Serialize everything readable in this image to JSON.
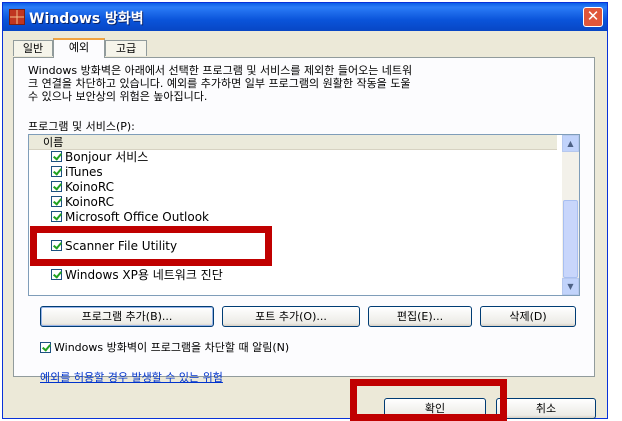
{
  "window": {
    "title": "Windows 방화벽",
    "close_symbol": "✕"
  },
  "tabs": [
    {
      "label": "일반"
    },
    {
      "label": "예외"
    },
    {
      "label": "고급"
    }
  ],
  "description_lines": [
    "Windows 방화벽은 아래에서 선택한 프로그램 및 서비스를 제외한 들어오는 네트워",
    "크 연결을 차단하고 있습니다. 예외를 추가하면 일부 프로그램의 원활한 작동을 도울",
    "수 있으나 보안상의 위험은 높아집니다."
  ],
  "programs_label": "프로그램 및 서비스(P):",
  "list": {
    "header": "이름",
    "items": [
      {
        "label": "Bonjour 서비스",
        "checked": true
      },
      {
        "label": "iTunes",
        "checked": true
      },
      {
        "label": "KoinoRC",
        "checked": true
      },
      {
        "label": "KoinoRC",
        "checked": true
      },
      {
        "label": "Microsoft Office Outlook",
        "checked": true
      },
      {
        "label": "Scanner File Utility",
        "checked": true
      },
      {
        "label": "Windows XP용 네트워크 진단",
        "checked": true
      }
    ]
  },
  "buttons": {
    "add_program": "프로그램 추가(B)...",
    "add_port": "포트 추가(O)...",
    "edit": "편집(E)...",
    "delete": "삭제(D)",
    "ok": "확인",
    "cancel": "취소"
  },
  "notify_checkbox": {
    "label": "Windows 방화벽이 프로그램을 차단할 때 알림(N)",
    "checked": true
  },
  "risk_link": "예외를 허용할 경우 발생할 수 있는 위험",
  "colors": {
    "highlight": "#c00000",
    "titlebar": "#0a54da",
    "dialog_bg": "#ece9d8"
  }
}
